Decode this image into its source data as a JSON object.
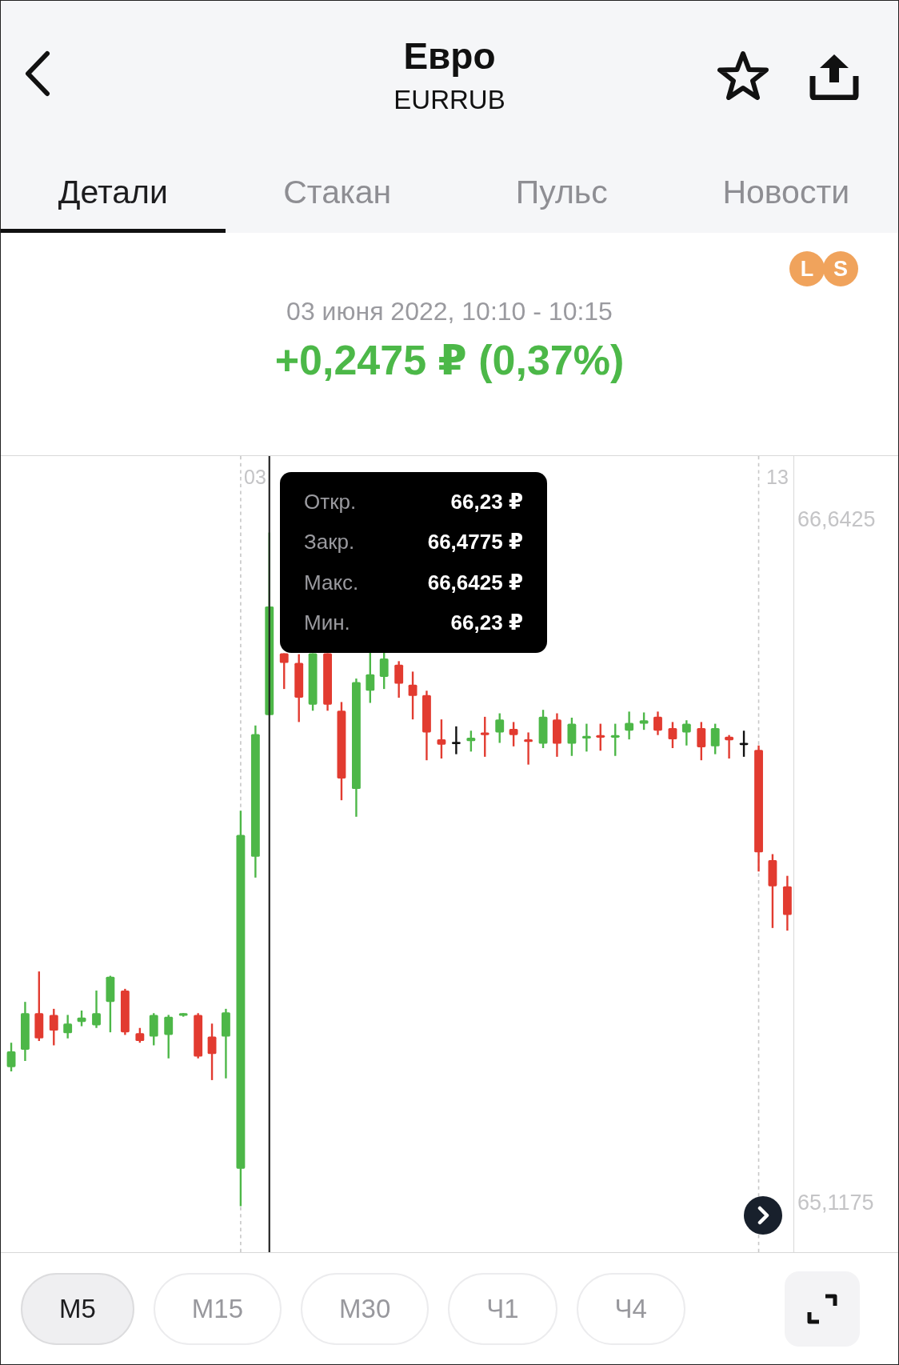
{
  "header": {
    "title": "Евро",
    "subtitle": "EURRUB"
  },
  "tabs": [
    {
      "label": "Детали",
      "selected": true
    },
    {
      "label": "Стакан",
      "selected": false
    },
    {
      "label": "Пульс",
      "selected": false
    },
    {
      "label": "Новости",
      "selected": false
    }
  ],
  "badges": [
    {
      "label": "L"
    },
    {
      "label": "S"
    }
  ],
  "period": "03 июня 2022, 10:10 - 10:15",
  "change": "+0,2475 ₽ (0,37%)",
  "chart": {
    "x_labels": [
      "03",
      "13"
    ],
    "y_labels": [
      "66,6425",
      "65,1175"
    ],
    "tooltip": [
      {
        "label": "Откр.",
        "value": "66,23 ₽"
      },
      {
        "label": "Закр.",
        "value": "66,4775 ₽"
      },
      {
        "label": "Макс.",
        "value": "66,6425 ₽"
      },
      {
        "label": "Мин.",
        "value": "66,23 ₽"
      }
    ]
  },
  "timeframes": [
    {
      "label": "М5",
      "selected": true
    },
    {
      "label": "М15",
      "selected": false
    },
    {
      "label": "М30",
      "selected": false
    },
    {
      "label": "Ч1",
      "selected": false
    },
    {
      "label": "Ч4",
      "selected": false
    }
  ]
}
